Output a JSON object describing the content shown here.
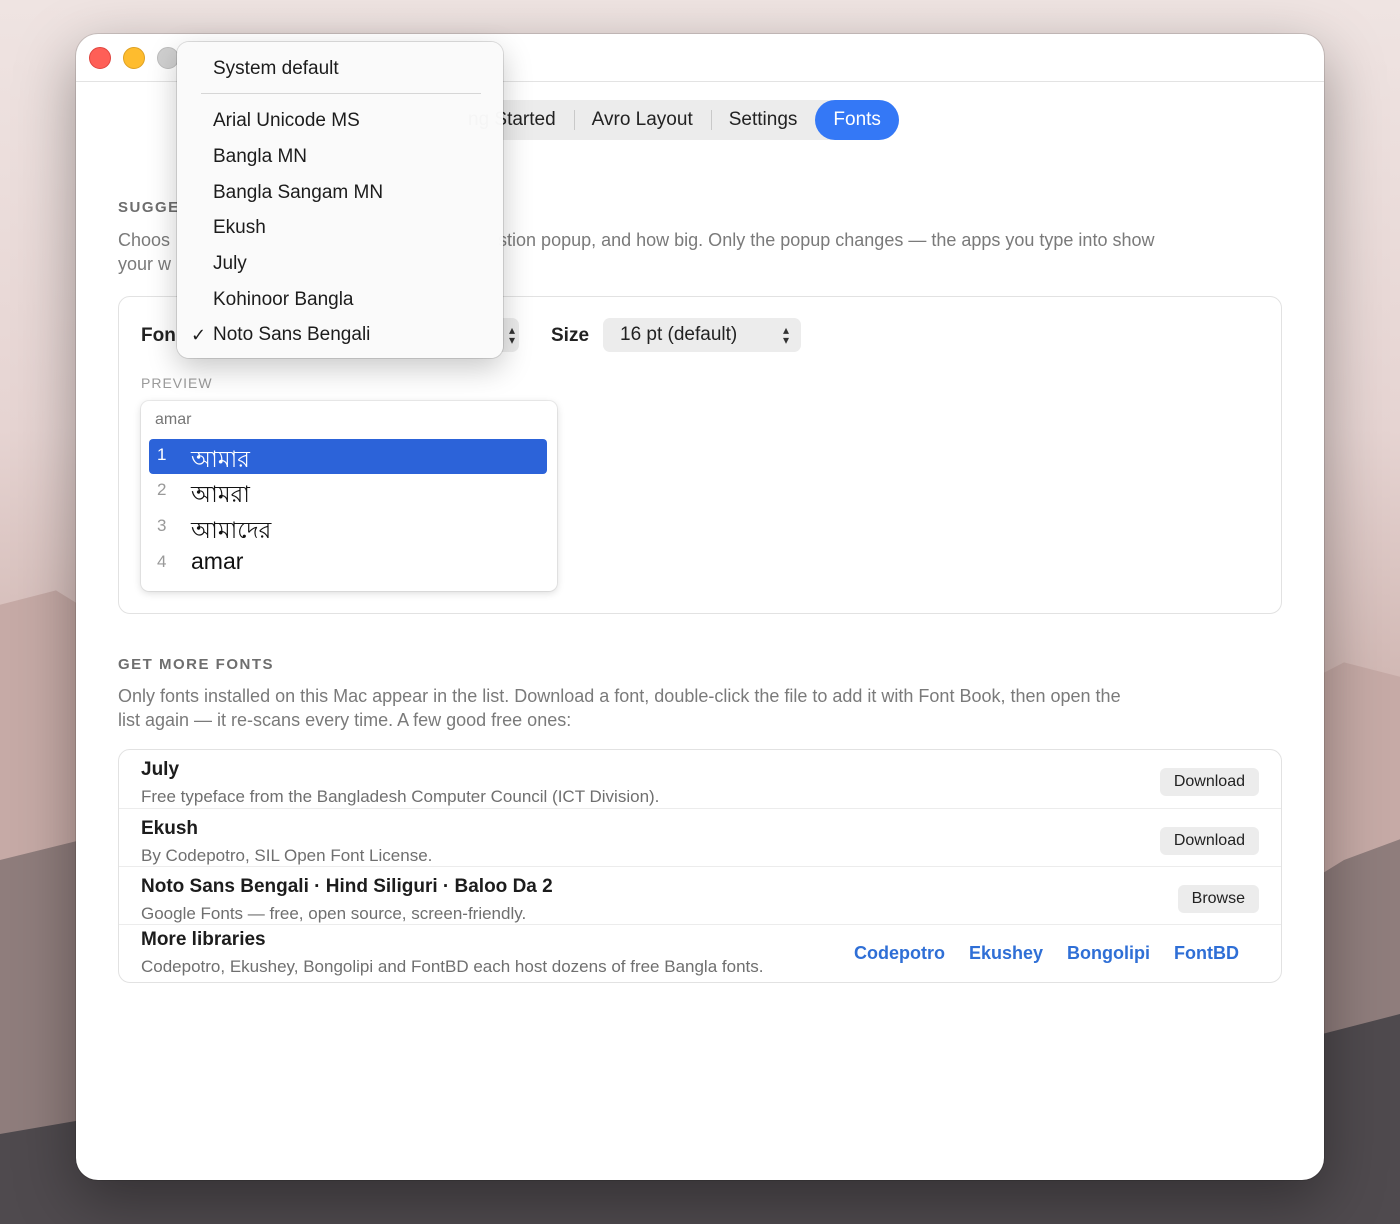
{
  "tabs": [
    {
      "label": "Getting Started",
      "visible_label": "ng Started",
      "active": false
    },
    {
      "label": "Avro Layout",
      "active": false
    },
    {
      "label": "Settings",
      "active": false
    },
    {
      "label": "Fonts",
      "active": true
    }
  ],
  "suggestion": {
    "heading": "SUGGE",
    "description_line1": "Choos",
    "description_line1_right": "stion popup, and how big. Only the popup changes — the apps you type into show",
    "description_line2": "your w",
    "font_label": "Fon",
    "size_label": "Size",
    "size_value": "16 pt (default)",
    "preview_label": "PREVIEW",
    "preview_input": "amar",
    "candidates": [
      {
        "num": "1",
        "word": "আমার",
        "selected": true
      },
      {
        "num": "2",
        "word": "আমরা",
        "selected": false
      },
      {
        "num": "3",
        "word": "আমাদের",
        "selected": false
      },
      {
        "num": "4",
        "word": "amar",
        "selected": false
      }
    ]
  },
  "font_menu": {
    "items": [
      {
        "label": "System default",
        "checked": false
      },
      {
        "label": "Arial Unicode MS",
        "checked": false
      },
      {
        "label": "Bangla MN",
        "checked": false
      },
      {
        "label": "Bangla Sangam MN",
        "checked": false
      },
      {
        "label": "Ekush",
        "checked": false
      },
      {
        "label": "July",
        "checked": false
      },
      {
        "label": "Kohinoor Bangla",
        "checked": false
      },
      {
        "label": "Noto Sans Bengali",
        "checked": true
      }
    ],
    "check_glyph": "✓"
  },
  "more_fonts": {
    "heading": "GET MORE FONTS",
    "description_line1": "Only fonts installed on this Mac appear in the list. Download a font, double-click the file to add it with Font Book, then open the",
    "description_line2": "list again — it re-scans every time. A few good free ones:",
    "rows": [
      {
        "title": "July",
        "desc": "Free typeface from the Bangladesh Computer Council (ICT Division).",
        "button": "Download"
      },
      {
        "title": "Ekush",
        "desc": "By Codepotro, SIL Open Font License.",
        "button": "Download"
      },
      {
        "title": "Noto Sans Bengali · Hind Siliguri · Baloo Da 2",
        "desc": "Google Fonts — free, open source, screen-friendly.",
        "button": "Browse"
      },
      {
        "title": "More libraries",
        "desc": "Codepotro, Ekushey, Bongolipi and FontBD each host dozens of free Bangla fonts.",
        "links": [
          "Codepotro",
          "Ekushey",
          "Bongolipi",
          "FontBD"
        ]
      }
    ]
  },
  "colors": {
    "accent": "#3478f6",
    "selection": "#2c63d9",
    "link": "#2f6fd6"
  }
}
